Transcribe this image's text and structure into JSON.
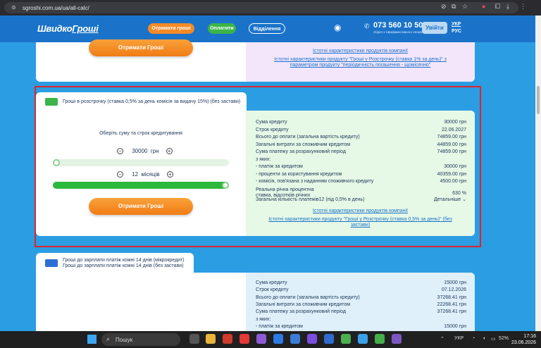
{
  "browser": {
    "url": "sgroshi.com.ua/ua/all-calc/"
  },
  "header": {
    "logo_part1": "Швидко",
    "logo_part2": "Гроші",
    "btn_get_money": "Отримати гроші",
    "btn_pay": "Оплатити",
    "btn_branches": "Відділення",
    "phone": "073 560 10 50",
    "phone_note": "Згідно з тарифами вашого оператора",
    "login": "Увійти",
    "lang_ua": "УКР",
    "lang_ru": "РУС"
  },
  "card_prev": {
    "button": "Отримати Гроші",
    "link1": "Істотні характеристики продуктів компанії",
    "link2": "Істотні характеристики продукту \"Гроші у Розстрочку (ставка 1% за день)\" з параметром продукту \"періодичність погашення - щомісячно\""
  },
  "card_main": {
    "title": "Гроші в розстрочку (ставка 0,5% за день комісія за видачу 15%) (без застави)",
    "choose_label": "Оберіть суму та строк кредитування",
    "amount_value": "30000",
    "amount_unit": "грн",
    "term_value": "12",
    "term_unit": "місяців",
    "amount_slider_fraction": 0.0,
    "term_slider_fraction": 1.0,
    "button": "Отримати Гроші",
    "rows": [
      {
        "label": "Сума кредиту",
        "value": "30000 грн"
      },
      {
        "label": "Строк кредиту",
        "value": "22.06.2027"
      },
      {
        "label": "Всього до оплати (загальна вартість кредиту)",
        "value": "74859.00 грн"
      },
      {
        "label": "Загальні витрати за споживчим кредитом",
        "value": "44859.00 грн"
      },
      {
        "label": "Сума платежу за розрахунковий період",
        "value": "74859.00 грн"
      },
      {
        "label": "з яких:",
        "value": ""
      },
      {
        "label": "- платіж за кредитом",
        "value": "30000 грн"
      },
      {
        "label": "- проценти за користування кредитом",
        "value": "40359.00 грн"
      },
      {
        "label": "- комісія, пов'язана з наданням споживчого кредиту",
        "value": "4500.00 грн"
      }
    ],
    "apr_label_line1": "Реальна річна процентна",
    "apr_label_line2": "ставка, відсоткіів річних",
    "apr_value": "630 %",
    "payments_label": "Загальна кількість платежів12 (під 0,5% в день)",
    "details": "Детальніше",
    "link1": "Істотні характеристики продуктів компанії",
    "link2": "Істотні характеристики продукту \"Гроші у Розстрочку (ставка 0,5% за день)\" (без застави)"
  },
  "card_next": {
    "title": "Гроші до зарплати платіж кожні 14 днів (мікрокредит) Гроші до зарплати платіж кожні 14 днів (без застави)",
    "rows": [
      {
        "label": "Сума кредиту",
        "value": "15000 грн"
      },
      {
        "label": "Строк кредиту",
        "value": "07.12.2026"
      },
      {
        "label": "Всього до оплати (загальна вартість кредиту)",
        "value": "37268.41 грн"
      },
      {
        "label": "Загальні витрати за споживчим кредитом",
        "value": "22268.41 грн"
      },
      {
        "label": "Сума платежу за розрахунковий період",
        "value": "37268.41 грн"
      },
      {
        "label": "з яких:",
        "value": ""
      },
      {
        "label": "- платіж за кредитом",
        "value": "15000 грн"
      }
    ]
  },
  "taskbar": {
    "search": "Пошук",
    "lang": "УКР",
    "battery": "52%",
    "time": "17:16",
    "date": "23.06.2026"
  }
}
